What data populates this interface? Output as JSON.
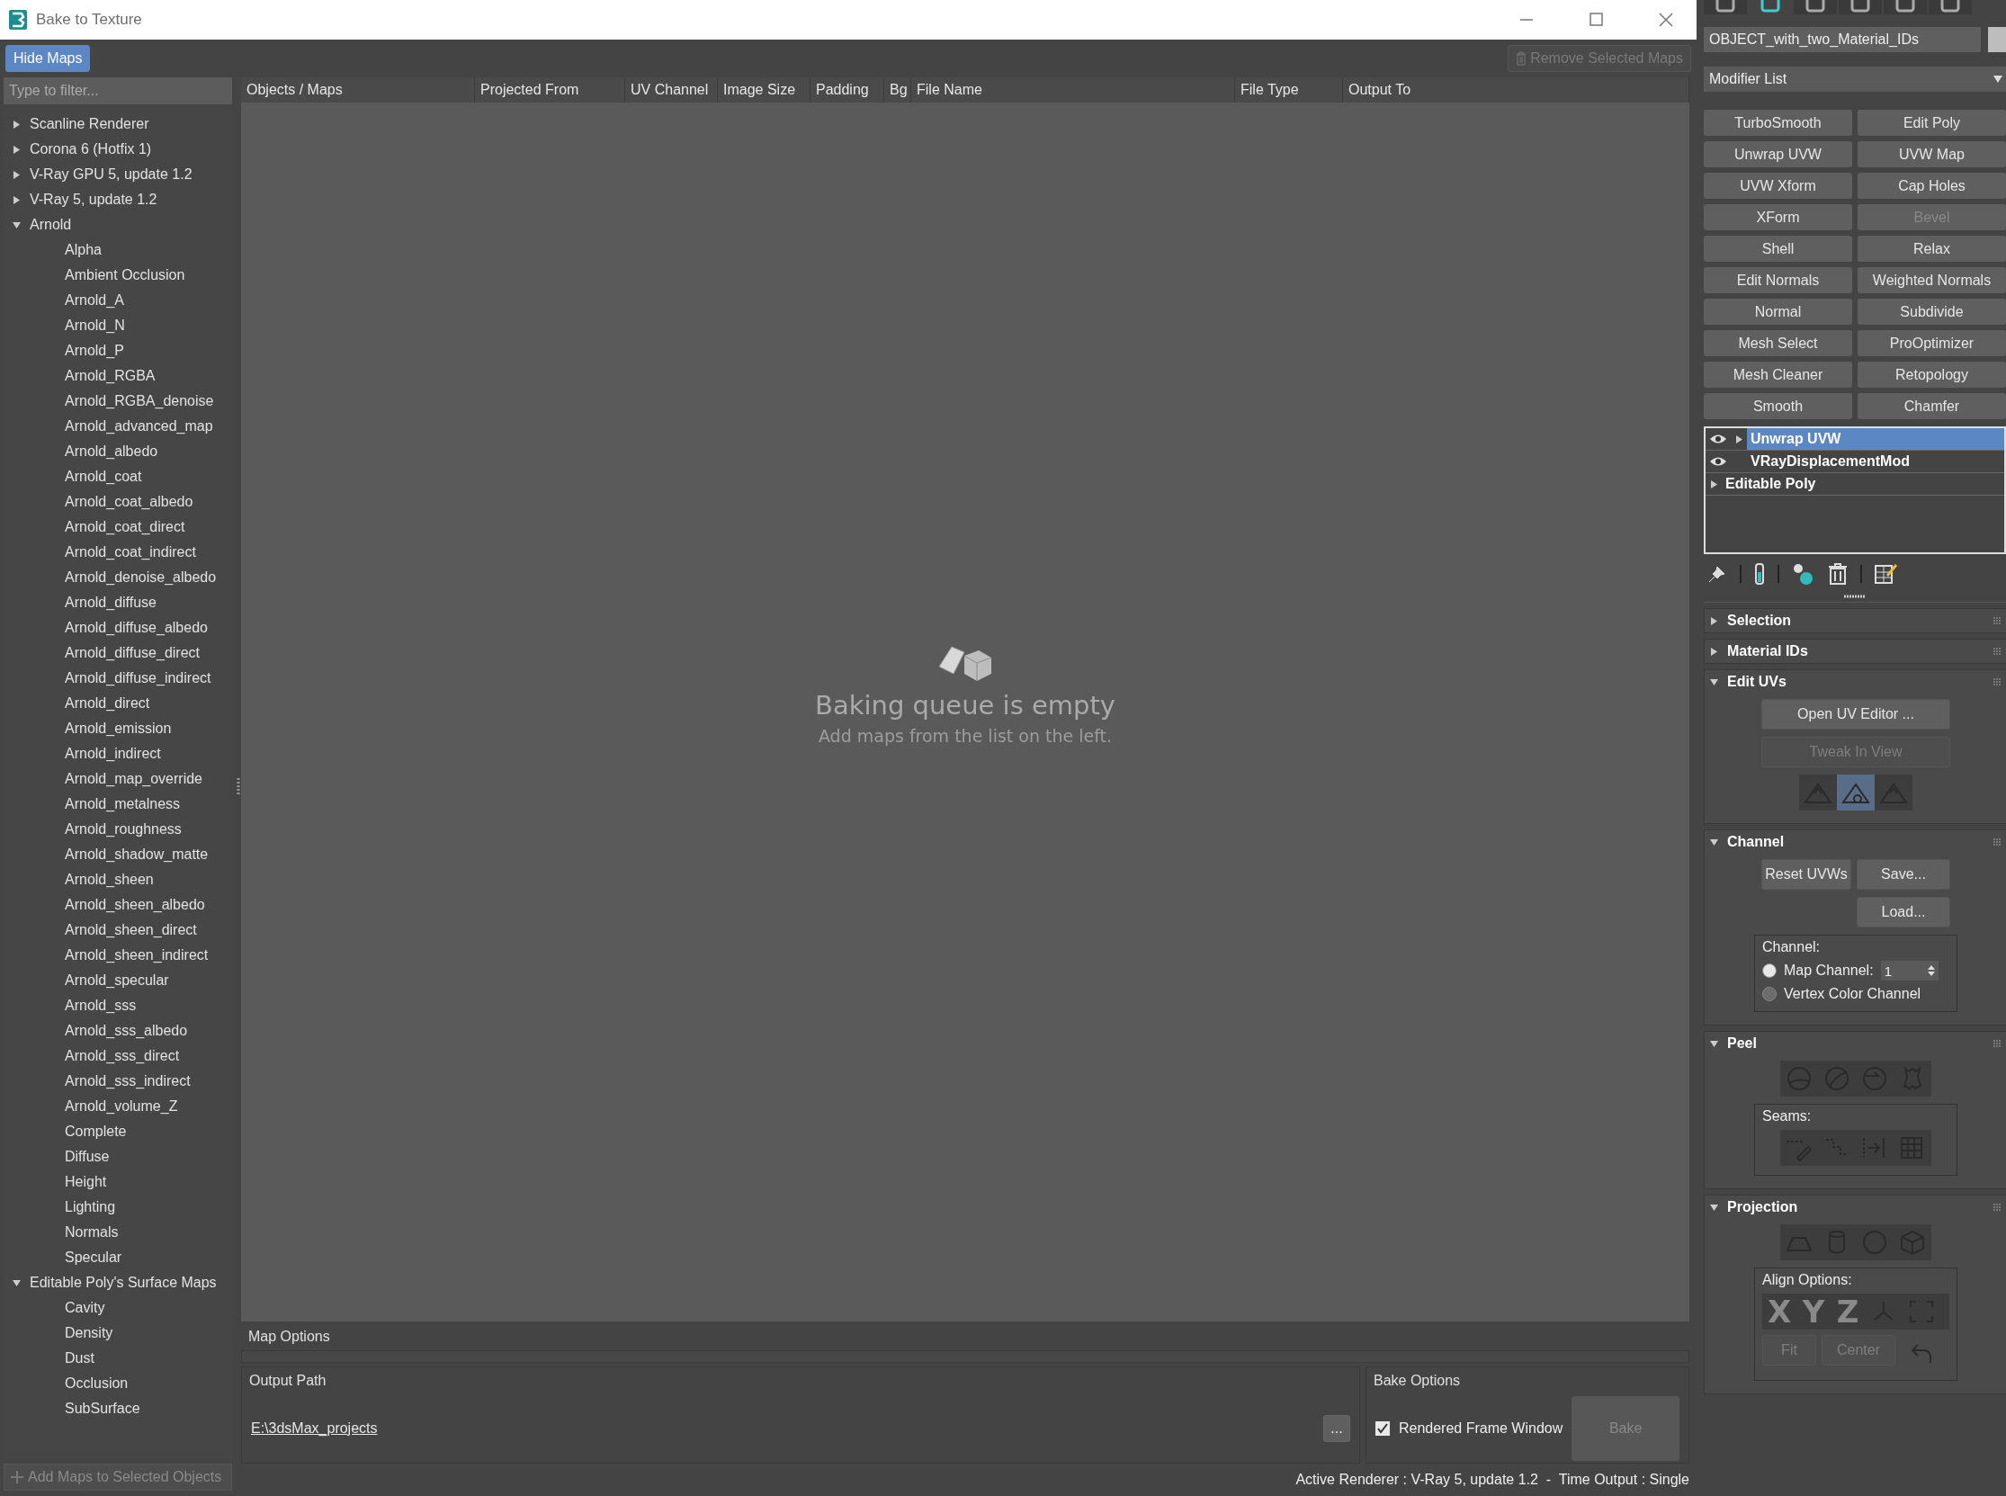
{
  "window": {
    "title": "Bake to Texture"
  },
  "toolbar": {
    "hide_maps": {
      "label": "Hide Maps",
      "selected": true
    },
    "remove_selected": {
      "label": "Remove Selected Maps",
      "disabled": true
    }
  },
  "sidebar": {
    "filter": {
      "placeholder": "Type to filter..."
    },
    "tree": [
      {
        "label": "Scanline Renderer",
        "expanded": false
      },
      {
        "label": "Corona 6 (Hotfix 1)",
        "expanded": false
      },
      {
        "label": "V-Ray GPU 5, update 1.2",
        "expanded": false
      },
      {
        "label": "V-Ray 5, update 1.2",
        "expanded": false
      },
      {
        "label": "Arnold",
        "expanded": true,
        "children": [
          {
            "label": "Alpha"
          },
          {
            "label": "Ambient Occlusion"
          },
          {
            "label": "Arnold_A"
          },
          {
            "label": "Arnold_N"
          },
          {
            "label": "Arnold_P"
          },
          {
            "label": "Arnold_RGBA"
          },
          {
            "label": "Arnold_RGBA_denoise"
          },
          {
            "label": "Arnold_advanced_map"
          },
          {
            "label": "Arnold_albedo"
          },
          {
            "label": "Arnold_coat"
          },
          {
            "label": "Arnold_coat_albedo"
          },
          {
            "label": "Arnold_coat_direct"
          },
          {
            "label": "Arnold_coat_indirect"
          },
          {
            "label": "Arnold_denoise_albedo"
          },
          {
            "label": "Arnold_diffuse"
          },
          {
            "label": "Arnold_diffuse_albedo"
          },
          {
            "label": "Arnold_diffuse_direct"
          },
          {
            "label": "Arnold_diffuse_indirect"
          },
          {
            "label": "Arnold_direct"
          },
          {
            "label": "Arnold_emission"
          },
          {
            "label": "Arnold_indirect"
          },
          {
            "label": "Arnold_map_override"
          },
          {
            "label": "Arnold_metalness"
          },
          {
            "label": "Arnold_roughness"
          },
          {
            "label": "Arnold_shadow_matte"
          },
          {
            "label": "Arnold_sheen"
          },
          {
            "label": "Arnold_sheen_albedo"
          },
          {
            "label": "Arnold_sheen_direct"
          },
          {
            "label": "Arnold_sheen_indirect"
          },
          {
            "label": "Arnold_specular"
          },
          {
            "label": "Arnold_sss"
          },
          {
            "label": "Arnold_sss_albedo"
          },
          {
            "label": "Arnold_sss_direct"
          },
          {
            "label": "Arnold_sss_indirect"
          },
          {
            "label": "Arnold_volume_Z"
          },
          {
            "label": "Complete"
          },
          {
            "label": "Diffuse"
          },
          {
            "label": "Height"
          },
          {
            "label": "Lighting"
          },
          {
            "label": "Normals"
          },
          {
            "label": "Specular"
          }
        ]
      },
      {
        "label": "Editable Poly's Surface Maps",
        "expanded": true,
        "children": [
          {
            "label": "Cavity"
          },
          {
            "label": "Density"
          },
          {
            "label": "Dust"
          },
          {
            "label": "Occlusion"
          },
          {
            "label": "SubSurface"
          }
        ]
      }
    ],
    "add_maps": {
      "label": "Add Maps to Selected Objects",
      "disabled": true
    }
  },
  "table": {
    "columns": [
      "Objects / Maps",
      "Projected From",
      "UV Channel",
      "Image Size",
      "Padding",
      "Bg",
      "File Name",
      "File Type",
      "Output To"
    ]
  },
  "empty_state": {
    "title": "Baking queue is empty",
    "subtitle": "Add maps from the list on the left."
  },
  "map_options": {
    "label": "Map Options"
  },
  "output_path": {
    "label": "Output Path",
    "value": "E:\\3dsMax_projects",
    "browse": "..."
  },
  "bake_options": {
    "label": "Bake Options",
    "rendered_frame_window": {
      "label": "Rendered Frame Window",
      "checked": true
    },
    "bake": {
      "label": "Bake",
      "disabled": true
    }
  },
  "status_bar": {
    "text": "Active Renderer : V-Ray 5, update 1.2  -  Time Output : Single"
  },
  "command_panel": {
    "tabs": [
      {
        "selected": false
      },
      {
        "selected": true
      },
      {
        "selected": false
      },
      {
        "selected": false
      },
      {
        "selected": false
      },
      {
        "selected": false
      }
    ],
    "object_name": "OBJECT_with_two_Material_IDs",
    "modifier_list": "Modifier List",
    "modifier_buttons": [
      {
        "label": "TurboSmooth",
        "disabled": false
      },
      {
        "label": "Edit Poly",
        "disabled": false
      },
      {
        "label": "Unwrap UVW",
        "disabled": false
      },
      {
        "label": "UVW Map",
        "disabled": false
      },
      {
        "label": "UVW Xform",
        "disabled": false
      },
      {
        "label": "Cap Holes",
        "disabled": false
      },
      {
        "label": "XForm",
        "disabled": false
      },
      {
        "label": "Bevel",
        "disabled": true
      },
      {
        "label": "Shell",
        "disabled": false
      },
      {
        "label": "Relax",
        "disabled": false
      },
      {
        "label": "Edit Normals",
        "disabled": false
      },
      {
        "label": "Weighted Normals",
        "disabled": false
      },
      {
        "label": "Normal",
        "disabled": false
      },
      {
        "label": "Subdivide",
        "disabled": false
      },
      {
        "label": "Mesh Select",
        "disabled": false
      },
      {
        "label": "ProOptimizer",
        "disabled": false
      },
      {
        "label": "Mesh Cleaner",
        "disabled": false
      },
      {
        "label": "Retopology",
        "disabled": false
      },
      {
        "label": "Smooth",
        "disabled": false
      },
      {
        "label": "Chamfer",
        "disabled": false
      }
    ],
    "stack": [
      {
        "label": "Unwrap UVW",
        "selected": true,
        "eye": true,
        "has_children": true
      },
      {
        "label": "VRayDisplacementMod",
        "selected": false,
        "eye": true,
        "has_children": false
      },
      {
        "label": "Editable Poly",
        "selected": false,
        "eye": false,
        "has_children": true
      }
    ],
    "rollouts": [
      {
        "title": "Selection",
        "expanded": false
      },
      {
        "title": "Material IDs",
        "expanded": false
      },
      {
        "kind": "edit_uvs",
        "title": "Edit UVs",
        "expanded": true,
        "buttons": [
          {
            "label": "Open UV Editor ...",
            "disabled": false
          },
          {
            "label": "Tweak In View",
            "disabled": true
          }
        ],
        "tools": [
          {
            "selected": false
          },
          {
            "selected": true
          },
          {
            "selected": false
          }
        ]
      },
      {
        "kind": "channel",
        "title": "Channel",
        "expanded": true,
        "buttons": [
          {
            "label": "Reset UVWs"
          },
          {
            "label": "Save..."
          },
          {
            "label": "Load..."
          }
        ],
        "group": "Channel:",
        "options": [
          {
            "label": "Map Channel:",
            "selected": true,
            "value": "1"
          },
          {
            "label": "Vertex Color Channel",
            "selected": false
          }
        ]
      },
      {
        "kind": "peel",
        "title": "Peel",
        "expanded": true,
        "group": "Seams:"
      },
      {
        "kind": "projection",
        "title": "Projection",
        "expanded": true,
        "group": "Align Options:",
        "axes": [
          "X",
          "Y",
          "Z"
        ],
        "buttons": [
          {
            "label": "Fit",
            "disabled": true
          },
          {
            "label": "Center",
            "disabled": true
          }
        ]
      }
    ]
  }
}
